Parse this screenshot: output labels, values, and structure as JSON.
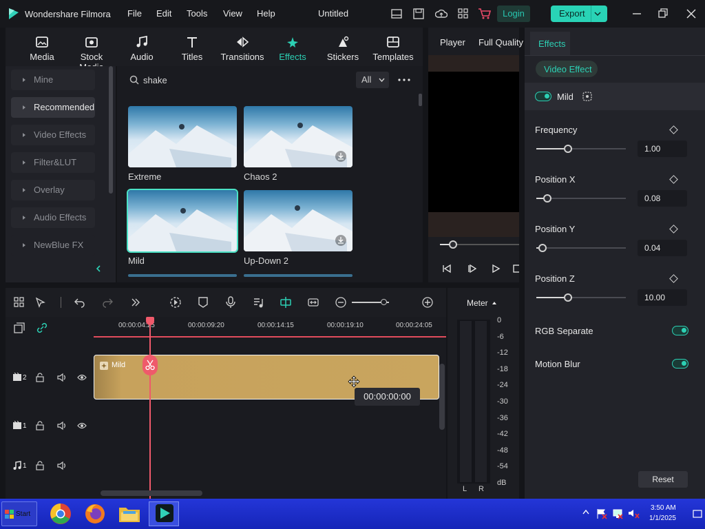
{
  "app": {
    "name": "Wondershare Filmora",
    "doc_title": "Untitled",
    "login": "Login",
    "export": "Export"
  },
  "menu": [
    "File",
    "Edit",
    "Tools",
    "View",
    "Help"
  ],
  "toolbar": [
    "Media",
    "Stock Media",
    "Audio",
    "Titles",
    "Transitions",
    "Effects",
    "Stickers",
    "Templates"
  ],
  "sidebar": [
    "Mine",
    "Recommended",
    "Video Effects",
    "Filter&LUT",
    "Overlay",
    "Audio Effects",
    "NewBlue FX"
  ],
  "search": {
    "value": "shake",
    "filter": "All"
  },
  "effects": [
    {
      "name": "Extreme"
    },
    {
      "name": "Chaos 2"
    },
    {
      "name": "Mild"
    },
    {
      "name": "Up-Down 2"
    }
  ],
  "player": {
    "tab": "Player",
    "quality": "Full Quality"
  },
  "panel": {
    "tab": "Effects",
    "subtab": "Video Effect",
    "effect_name": "Mild",
    "props": [
      {
        "label": "Frequency",
        "value": "1.00",
        "fraction": 0.35
      },
      {
        "label": "Position X",
        "value": "0.08",
        "fraction": 0.12
      },
      {
        "label": "Position Y",
        "value": "0.04",
        "fraction": 0.07
      },
      {
        "label": "Position Z",
        "value": "10.00",
        "fraction": 0.35
      }
    ],
    "rgb": "RGB Separate",
    "blur": "Motion Blur",
    "reset": "Reset"
  },
  "timeline": {
    "timecodes": [
      "00:00:04:25",
      "00:00:09:20",
      "00:00:14:15",
      "00:00:19:10",
      "00:00:24:05"
    ],
    "clip": "Mild",
    "tooltip": "00:00:00:00",
    "tracks": [
      "2",
      "1",
      "1"
    ]
  },
  "meter": {
    "label": "Meter",
    "scale": [
      "0",
      "-6",
      "-12",
      "-18",
      "-24",
      "-30",
      "-36",
      "-42",
      "-48",
      "-54",
      "dB"
    ],
    "l": "L",
    "r": "R"
  },
  "taskbar": {
    "start": "Start",
    "time": "3:50 AM",
    "date": "1/1/2025"
  }
}
